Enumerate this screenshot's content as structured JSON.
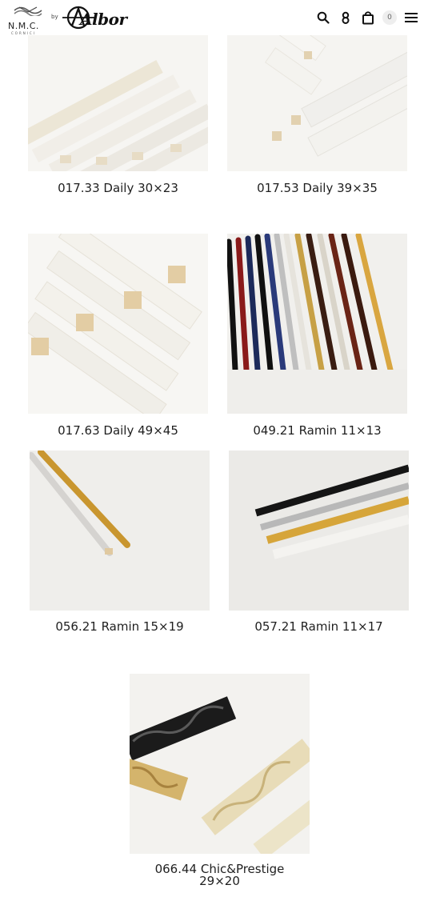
{
  "header": {
    "logo_nmc": "N.M.C.",
    "logo_cornici": "CORNICI",
    "logo_by": "by",
    "logo_albor": "Albor",
    "cart_count": "0",
    "icons": [
      "search-icon",
      "user-icon",
      "cart-icon",
      "menu-icon"
    ]
  },
  "products": [
    {
      "title": "017.33 Daily 30×23"
    },
    {
      "title": "017.53 Daily 39×35"
    },
    {
      "title": "017.63 Daily 49×45"
    },
    {
      "title": "049.21 Ramin 11×13"
    },
    {
      "title": "056.21 Ramin 15×19"
    },
    {
      "title": "057.21 Ramin 11×17"
    },
    {
      "title_line1": "066.44 Chic&Prestige",
      "title_line2": "29×20"
    }
  ]
}
